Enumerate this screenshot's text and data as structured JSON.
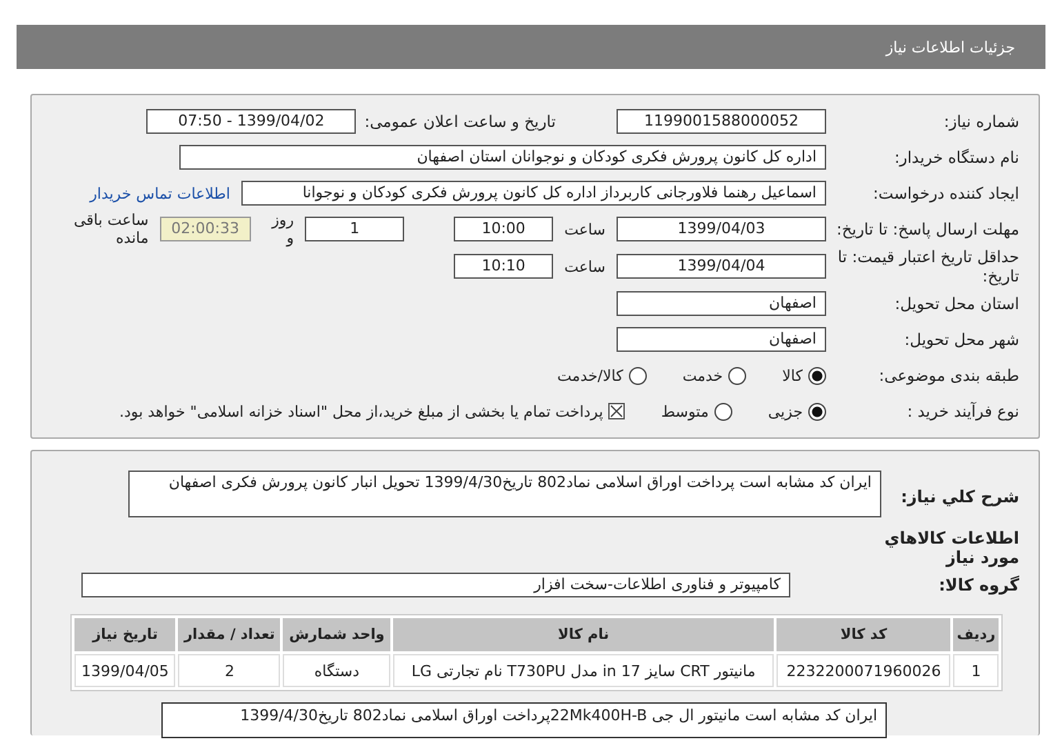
{
  "header": {
    "title": "جزئیات اطلاعات نیاز"
  },
  "need_number": {
    "label": "شماره نیاز:",
    "value": "1199001588000052"
  },
  "announce": {
    "label": "تاریخ و ساعت اعلان عمومی:",
    "value": "1399/04/02 - 07:50"
  },
  "buyer": {
    "label": "نام دستگاه خریدار:",
    "value": "اداره کل کانون پرورش فکری کودکان و نوجوانان استان اصفهان"
  },
  "creator": {
    "label": "ایجاد کننده درخواست:",
    "value": "اسماعیل رهنما فلاورجانی کاربرداز اداره کل کانون پرورش فکری کودکان و نوجوانا",
    "link": "اطلاعات تماس خریدار"
  },
  "deadline": {
    "label": "مهلت ارسال پاسخ: تا تاریخ:",
    "date": "1399/04/03",
    "time_label": "ساعت",
    "time": "10:00",
    "days": "1",
    "days_label": "روز و",
    "remaining": "02:00:33",
    "remaining_label": "ساعت باقی مانده"
  },
  "validity": {
    "label": "حداقل تاریخ اعتبار قیمت: تا تاریخ:",
    "date": "1399/04/04",
    "time_label": "ساعت",
    "time": "10:10"
  },
  "province": {
    "label": "استان محل تحویل:",
    "value": "اصفهان"
  },
  "city": {
    "label": "شهر محل تحویل:",
    "value": "اصفهان"
  },
  "category": {
    "label": "طبقه بندی موضوعی:",
    "options": [
      {
        "label": "کالا",
        "selected": true
      },
      {
        "label": "خدمت",
        "selected": false
      },
      {
        "label": "کالا/خدمت",
        "selected": false
      }
    ]
  },
  "process": {
    "label": "نوع فرآیند خرید :",
    "options": [
      {
        "label": "جزیی",
        "selected": true
      },
      {
        "label": "متوسط",
        "selected": false
      }
    ],
    "treasury": {
      "label": "پرداخت تمام یا بخشی از مبلغ خرید،از محل \"اسناد خزانه اسلامی\" خواهد بود.",
      "checked": true
    }
  },
  "description": {
    "label": "شرح کلي نياز:",
    "value": "ایران کد مشابه است پرداخت اوراق اسلامی نماد802 تاریخ1399/4/30 تحویل انبار کانون پرورش فکری اصفهان"
  },
  "goods_heading": "اطلاعات کالاهاي مورد نياز",
  "goods_group": {
    "label": "گروه کالا:",
    "value": "کامپیوتر و فناوری اطلاعات-سخت افزار"
  },
  "table": {
    "columns": [
      "ردیف",
      "کد کالا",
      "نام کالا",
      "واحد شمارش",
      "تعداد / مقدار",
      "تاریخ نیاز"
    ],
    "rows": [
      [
        "1",
        "2232200071960026",
        "مانیتور CRT سایز 17 in مدل T730PU نام تجارتی LG",
        "دستگاه",
        "2",
        "1399/04/05"
      ]
    ]
  },
  "note": "ایران کد مشابه است  مانیتور ال جی 22Mk400H-Bپرداخت اوراق اسلامی نماد802 تاریخ1399/4/30"
}
